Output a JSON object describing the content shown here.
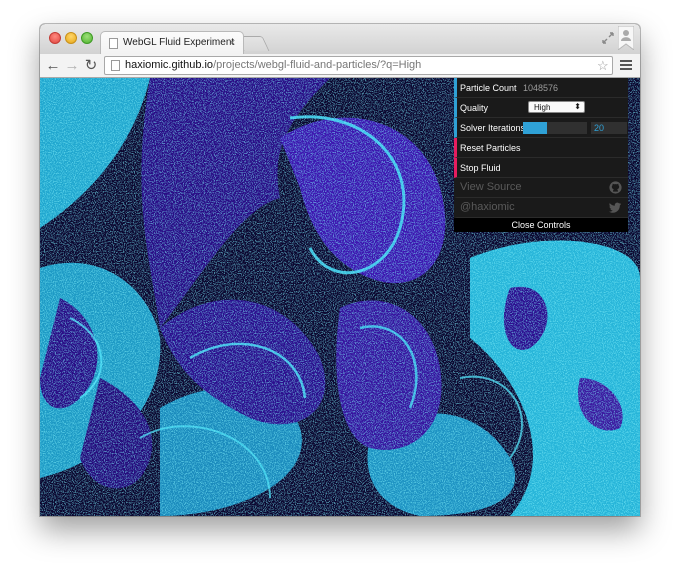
{
  "browser": {
    "tab_title": "WebGL Fluid Experiment",
    "tab_close": "×",
    "url_host": "haxiomic.github.io",
    "url_path": "/projects/webgl-fluid-and-particles/?q=High",
    "back": "←",
    "forward": "→",
    "reload": "↻",
    "star": "☆"
  },
  "controls": {
    "particle_count_label": "Particle Count",
    "particle_count_value": "1048576",
    "quality_label": "Quality",
    "quality_value": "High",
    "quality_arrow": "⬍",
    "solver_label": "Solver Iterations",
    "solver_value": "20",
    "solver_fraction": 0.38,
    "reset_label": "Reset Particles",
    "stop_label": "Stop Fluid",
    "view_source_label": "View Source",
    "twitter_label": "@haxiomic",
    "close_label": "Close Controls"
  },
  "colors": {
    "number_accent": "#2fa1d6",
    "function_accent": "#e61d5f",
    "fluid_purple": "#3a12a8",
    "fluid_cyan": "#33d6f0"
  },
  "icons": [
    "page-icon",
    "back-arrow-icon",
    "forward-arrow-icon",
    "reload-icon",
    "star-icon",
    "menu-icon",
    "github-icon",
    "twitter-icon",
    "expand-icon",
    "user-icon"
  ]
}
